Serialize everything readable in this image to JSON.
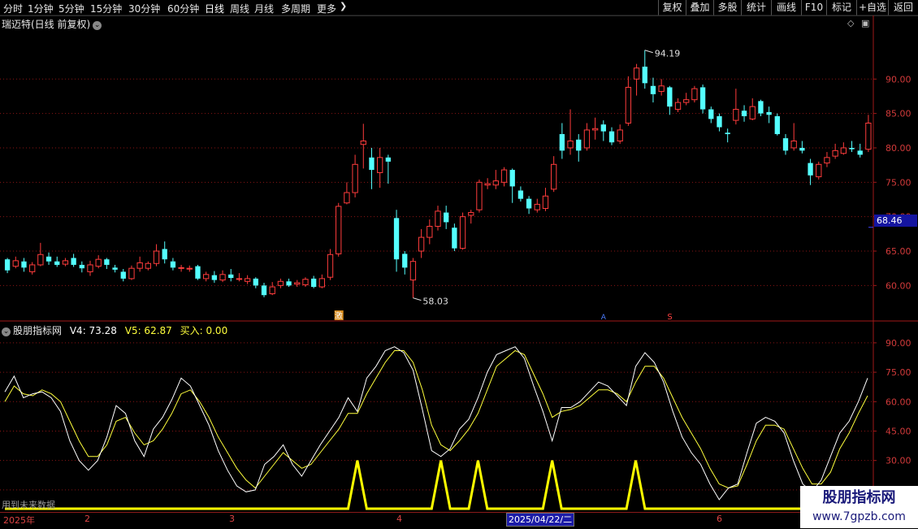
{
  "toolbar": {
    "tabs": [
      "分时",
      "1分钟",
      "5分钟",
      "15分钟",
      "30分钟",
      "60分钟",
      "日线",
      "周线",
      "月线",
      "多周期",
      "更多"
    ],
    "active_tab": "日线",
    "right_buttons": [
      "复权",
      "叠加",
      "多股",
      "统计",
      "画线",
      "F10",
      "标记",
      "+自选",
      "返回"
    ]
  },
  "chart": {
    "title": "瑞迈特(日线 前复权)",
    "high_label": "94.19",
    "low_label": "58.03",
    "current_price": "68.46",
    "event_marker": "激",
    "marker_glyph_a": "A",
    "marker_glyph_b": "S"
  },
  "price_axis": {
    "ticks": [
      "90.00",
      "85.00",
      "80.00",
      "75.00",
      "70.00",
      "65.00",
      "60.00"
    ],
    "tick_values": [
      90,
      85,
      80,
      75,
      70,
      65,
      60
    ],
    "range": [
      55.2,
      97.0
    ]
  },
  "indicator": {
    "name": "股朋指标网",
    "v4": "V4: 73.28",
    "v5": "V5: 62.87",
    "buy": "买入: 0.00",
    "ticks": [
      "90.00",
      "75.00",
      "60.00",
      "45.00",
      "30.00",
      "15.00"
    ],
    "tick_values": [
      90,
      75,
      60,
      45,
      30,
      15
    ],
    "range": [
      5,
      97
    ],
    "future_note": "用到未来数据"
  },
  "time_axis": {
    "labels": [
      "2025年",
      "2",
      "3",
      "4",
      "2025/04/22/二",
      "6"
    ]
  },
  "watermark": {
    "line1": "股朋指标网",
    "line2": "www.7gpzb.com"
  },
  "colors": {
    "up": "#ff3c3c",
    "down": "#54ffff",
    "v4_line": "#ffffff",
    "v5_line": "#ffff3c",
    "buy_line": "#ffff00",
    "grid": "#8a1414"
  },
  "chart_data": {
    "type": "candlestick",
    "candles": [
      {
        "o": 63.8,
        "c": 62.2,
        "h": 64.0,
        "l": 61.8
      },
      {
        "o": 62.8,
        "c": 63.6,
        "h": 64.2,
        "l": 62.5
      },
      {
        "o": 63.5,
        "c": 62.6,
        "h": 64.0,
        "l": 62.0
      },
      {
        "o": 62.0,
        "c": 63.0,
        "h": 63.4,
        "l": 61.6
      },
      {
        "o": 63.0,
        "c": 64.5,
        "h": 66.2,
        "l": 62.8
      },
      {
        "o": 64.2,
        "c": 63.5,
        "h": 64.8,
        "l": 63.0
      },
      {
        "o": 63.5,
        "c": 63.0,
        "h": 64.2,
        "l": 62.7
      },
      {
        "o": 63.1,
        "c": 63.6,
        "h": 64.0,
        "l": 62.8
      },
      {
        "o": 64.0,
        "c": 63.0,
        "h": 64.6,
        "l": 62.7
      },
      {
        "o": 63.0,
        "c": 62.5,
        "h": 63.5,
        "l": 61.9
      },
      {
        "o": 62.0,
        "c": 63.0,
        "h": 63.6,
        "l": 61.4
      },
      {
        "o": 62.8,
        "c": 63.8,
        "h": 64.4,
        "l": 62.5
      },
      {
        "o": 63.8,
        "c": 63.0,
        "h": 64.0,
        "l": 62.4
      },
      {
        "o": 62.6,
        "c": 62.3,
        "h": 63.0,
        "l": 61.9
      },
      {
        "o": 62.0,
        "c": 61.0,
        "h": 62.4,
        "l": 60.6
      },
      {
        "o": 61.0,
        "c": 62.5,
        "h": 62.9,
        "l": 60.8
      },
      {
        "o": 62.5,
        "c": 63.3,
        "h": 64.2,
        "l": 62.0
      },
      {
        "o": 62.5,
        "c": 63.2,
        "h": 63.5,
        "l": 62.2
      },
      {
        "o": 63.2,
        "c": 65.0,
        "h": 66.0,
        "l": 62.8
      },
      {
        "o": 65.3,
        "c": 63.8,
        "h": 66.4,
        "l": 63.2
      },
      {
        "o": 63.5,
        "c": 62.6,
        "h": 64.0,
        "l": 62.2
      },
      {
        "o": 62.5,
        "c": 62.6,
        "h": 63.0,
        "l": 62.0
      },
      {
        "o": 62.4,
        "c": 62.5,
        "h": 62.9,
        "l": 62.0
      },
      {
        "o": 62.8,
        "c": 61.0,
        "h": 63.0,
        "l": 60.8
      },
      {
        "o": 61.0,
        "c": 61.6,
        "h": 62.0,
        "l": 60.6
      },
      {
        "o": 61.5,
        "c": 60.8,
        "h": 62.1,
        "l": 60.4
      },
      {
        "o": 60.8,
        "c": 61.6,
        "h": 62.2,
        "l": 60.5
      },
      {
        "o": 61.6,
        "c": 61.1,
        "h": 62.4,
        "l": 60.6
      },
      {
        "o": 61.0,
        "c": 61.0,
        "h": 61.8,
        "l": 60.6
      },
      {
        "o": 60.6,
        "c": 61.0,
        "h": 61.5,
        "l": 60.2
      },
      {
        "o": 61.0,
        "c": 60.0,
        "h": 61.2,
        "l": 59.6
      },
      {
        "o": 60.0,
        "c": 58.6,
        "h": 60.4,
        "l": 58.3
      },
      {
        "o": 58.8,
        "c": 59.8,
        "h": 60.5,
        "l": 58.6
      },
      {
        "o": 60.0,
        "c": 60.6,
        "h": 61.0,
        "l": 59.6
      },
      {
        "o": 60.6,
        "c": 60.0,
        "h": 61.0,
        "l": 59.8
      },
      {
        "o": 60.2,
        "c": 60.4,
        "h": 60.8,
        "l": 59.8
      },
      {
        "o": 60.1,
        "c": 60.9,
        "h": 61.2,
        "l": 59.8
      },
      {
        "o": 61.0,
        "c": 59.8,
        "h": 61.4,
        "l": 59.6
      },
      {
        "o": 59.8,
        "c": 61.0,
        "h": 61.6,
        "l": 59.6
      },
      {
        "o": 61.2,
        "c": 64.5,
        "h": 65.3,
        "l": 60.8
      },
      {
        "o": 64.6,
        "c": 71.5,
        "h": 72.0,
        "l": 64.2
      },
      {
        "o": 72.0,
        "c": 73.5,
        "h": 75.0,
        "l": 71.8
      },
      {
        "o": 73.5,
        "c": 77.6,
        "h": 79.0,
        "l": 72.8
      },
      {
        "o": 80.5,
        "c": 81.0,
        "h": 83.5,
        "l": 77.0
      },
      {
        "o": 78.6,
        "c": 76.8,
        "h": 80.0,
        "l": 74.0
      },
      {
        "o": 76.4,
        "c": 78.6,
        "h": 80.0,
        "l": 74.2
      },
      {
        "o": 78.6,
        "c": 78.0,
        "h": 79.0,
        "l": 74.8
      },
      {
        "o": 69.8,
        "c": 63.8,
        "h": 71.0,
        "l": 62.0
      },
      {
        "o": 64.6,
        "c": 62.6,
        "h": 65.0,
        "l": 61.6
      },
      {
        "o": 60.8,
        "c": 63.5,
        "h": 64.0,
        "l": 58.2
      },
      {
        "o": 65.0,
        "c": 67.0,
        "h": 68.2,
        "l": 64.0
      },
      {
        "o": 67.0,
        "c": 68.6,
        "h": 69.6,
        "l": 66.0
      },
      {
        "o": 68.6,
        "c": 70.8,
        "h": 71.6,
        "l": 68.0
      },
      {
        "o": 70.6,
        "c": 69.2,
        "h": 71.6,
        "l": 68.2
      },
      {
        "o": 68.4,
        "c": 65.4,
        "h": 69.0,
        "l": 65.0
      },
      {
        "o": 65.4,
        "c": 70.0,
        "h": 70.6,
        "l": 65.2
      },
      {
        "o": 70.2,
        "c": 70.6,
        "h": 71.0,
        "l": 69.0
      },
      {
        "o": 71.0,
        "c": 75.0,
        "h": 75.4,
        "l": 70.6
      },
      {
        "o": 74.6,
        "c": 74.8,
        "h": 75.6,
        "l": 74.0
      },
      {
        "o": 74.6,
        "c": 75.2,
        "h": 76.8,
        "l": 74.0
      },
      {
        "o": 75.0,
        "c": 76.8,
        "h": 77.2,
        "l": 74.4
      },
      {
        "o": 76.8,
        "c": 74.4,
        "h": 77.0,
        "l": 72.0
      },
      {
        "o": 73.8,
        "c": 72.6,
        "h": 74.4,
        "l": 72.2
      },
      {
        "o": 72.6,
        "c": 71.2,
        "h": 73.0,
        "l": 70.4
      },
      {
        "o": 71.0,
        "c": 71.8,
        "h": 72.6,
        "l": 70.6
      },
      {
        "o": 71.2,
        "c": 73.0,
        "h": 74.2,
        "l": 70.8
      },
      {
        "o": 74.0,
        "c": 77.6,
        "h": 78.8,
        "l": 73.6
      },
      {
        "o": 82.0,
        "c": 79.6,
        "h": 83.6,
        "l": 78.4
      },
      {
        "o": 80.0,
        "c": 81.0,
        "h": 85.6,
        "l": 79.0
      },
      {
        "o": 81.2,
        "c": 79.6,
        "h": 82.0,
        "l": 78.0
      },
      {
        "o": 80.0,
        "c": 82.6,
        "h": 83.6,
        "l": 79.6
      },
      {
        "o": 82.6,
        "c": 82.8,
        "h": 84.4,
        "l": 81.2
      },
      {
        "o": 83.4,
        "c": 82.4,
        "h": 84.0,
        "l": 81.0
      },
      {
        "o": 82.4,
        "c": 80.8,
        "h": 83.0,
        "l": 80.4
      },
      {
        "o": 81.0,
        "c": 82.6,
        "h": 83.4,
        "l": 80.6
      },
      {
        "o": 83.6,
        "c": 88.8,
        "h": 90.4,
        "l": 83.2
      },
      {
        "o": 90.0,
        "c": 91.6,
        "h": 92.2,
        "l": 87.6
      },
      {
        "o": 91.8,
        "c": 89.4,
        "h": 94.2,
        "l": 88.6
      },
      {
        "o": 89.0,
        "c": 87.8,
        "h": 90.2,
        "l": 86.6
      },
      {
        "o": 88.2,
        "c": 89.0,
        "h": 90.0,
        "l": 87.6
      },
      {
        "o": 88.8,
        "c": 86.0,
        "h": 89.0,
        "l": 84.8
      },
      {
        "o": 85.6,
        "c": 86.6,
        "h": 87.2,
        "l": 85.2
      },
      {
        "o": 86.6,
        "c": 87.0,
        "h": 88.0,
        "l": 86.2
      },
      {
        "o": 87.0,
        "c": 88.6,
        "h": 89.0,
        "l": 86.6
      },
      {
        "o": 88.8,
        "c": 85.6,
        "h": 89.2,
        "l": 85.0
      },
      {
        "o": 85.6,
        "c": 84.2,
        "h": 86.0,
        "l": 83.6
      },
      {
        "o": 84.6,
        "c": 83.0,
        "h": 85.0,
        "l": 82.4
      },
      {
        "o": 82.2,
        "c": 82.0,
        "h": 82.8,
        "l": 80.8
      },
      {
        "o": 84.0,
        "c": 85.6,
        "h": 88.6,
        "l": 83.4
      },
      {
        "o": 85.4,
        "c": 84.6,
        "h": 86.2,
        "l": 83.8
      },
      {
        "o": 84.2,
        "c": 86.0,
        "h": 87.2,
        "l": 84.0
      },
      {
        "o": 86.8,
        "c": 85.0,
        "h": 87.0,
        "l": 84.6
      },
      {
        "o": 85.2,
        "c": 84.8,
        "h": 86.0,
        "l": 83.6
      },
      {
        "o": 84.6,
        "c": 82.0,
        "h": 85.0,
        "l": 81.8
      },
      {
        "o": 81.4,
        "c": 79.6,
        "h": 82.0,
        "l": 79.0
      },
      {
        "o": 80.0,
        "c": 81.0,
        "h": 83.6,
        "l": 79.6
      },
      {
        "o": 80.0,
        "c": 79.6,
        "h": 81.0,
        "l": 79.2
      },
      {
        "o": 77.8,
        "c": 76.0,
        "h": 78.4,
        "l": 74.6
      },
      {
        "o": 75.8,
        "c": 77.6,
        "h": 78.0,
        "l": 75.4
      },
      {
        "o": 77.8,
        "c": 78.6,
        "h": 79.4,
        "l": 77.2
      },
      {
        "o": 78.8,
        "c": 79.6,
        "h": 80.6,
        "l": 78.4
      },
      {
        "o": 79.2,
        "c": 80.0,
        "h": 80.8,
        "l": 79.0
      },
      {
        "o": 80.0,
        "c": 79.8,
        "h": 81.0,
        "l": 79.4
      },
      {
        "o": 79.6,
        "c": 79.0,
        "h": 80.6,
        "l": 78.6
      },
      {
        "o": 79.8,
        "c": 83.6,
        "h": 84.8,
        "l": 79.4
      }
    ],
    "v4": [
      65,
      73,
      62,
      64,
      65,
      62,
      55,
      40,
      30,
      25,
      30,
      42,
      58,
      54,
      40,
      32,
      46,
      52,
      61,
      72,
      68,
      58,
      48,
      35,
      25,
      17,
      14,
      15,
      28,
      32,
      38,
      28,
      22,
      30,
      38,
      45,
      52,
      62,
      55,
      72,
      78,
      86,
      88,
      85,
      76,
      56,
      35,
      32,
      36,
      46,
      51,
      62,
      75,
      84,
      86,
      88,
      82,
      68,
      55,
      40,
      57,
      57,
      60,
      65,
      70,
      68,
      63,
      58,
      78,
      85,
      80,
      70,
      55,
      42,
      34,
      28,
      18,
      10,
      16,
      18,
      34,
      49,
      52,
      50,
      44,
      30,
      18,
      14,
      20,
      32,
      44,
      50,
      60,
      72
    ],
    "v5": [
      60,
      68,
      64,
      63,
      66,
      64,
      60,
      50,
      40,
      32,
      32,
      38,
      50,
      52,
      44,
      38,
      40,
      46,
      54,
      64,
      66,
      60,
      52,
      42,
      34,
      26,
      20,
      16,
      22,
      28,
      34,
      30,
      26,
      28,
      34,
      40,
      46,
      54,
      54,
      64,
      72,
      80,
      86,
      86,
      80,
      66,
      48,
      38,
      35,
      40,
      46,
      54,
      66,
      78,
      82,
      86,
      84,
      74,
      64,
      52,
      55,
      56,
      58,
      62,
      66,
      66,
      64,
      60,
      70,
      78,
      78,
      72,
      62,
      52,
      44,
      36,
      26,
      18,
      16,
      17,
      28,
      40,
      48,
      48,
      46,
      36,
      26,
      18,
      18,
      24,
      36,
      44,
      54,
      63
    ],
    "buy": [
      0,
      0,
      0,
      0,
      0,
      0,
      0,
      0,
      0,
      0,
      0,
      0,
      0,
      0,
      0,
      0,
      0,
      0,
      0,
      0,
      0,
      0,
      0,
      0,
      0,
      0,
      0,
      0,
      0,
      0,
      0,
      0,
      0,
      0,
      0,
      0,
      0,
      0,
      30,
      0,
      0,
      0,
      0,
      0,
      0,
      0,
      0,
      30,
      0,
      0,
      0,
      30,
      0,
      0,
      0,
      0,
      0,
      0,
      0,
      30,
      0,
      0,
      0,
      0,
      0,
      0,
      0,
      0,
      30,
      0,
      0,
      0,
      0,
      0,
      0,
      0,
      0,
      0,
      0,
      0,
      0,
      0,
      0,
      0,
      0,
      0,
      0,
      0,
      0,
      0,
      0,
      0,
      0,
      0
    ]
  }
}
